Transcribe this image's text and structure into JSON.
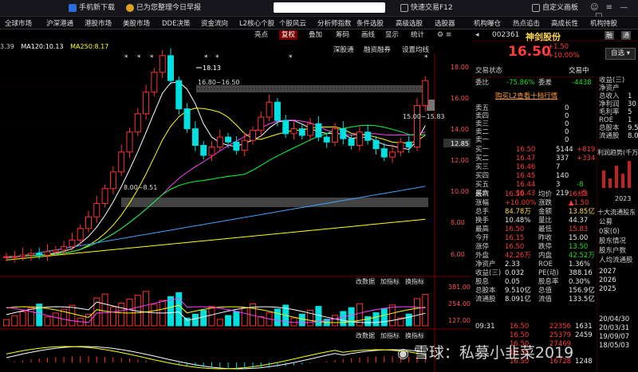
{
  "topbar": {
    "mobile_download": "手机新下载",
    "notice": "已为您整理今日早报",
    "search_placeholder": "",
    "fast_trade": "快速交易F12",
    "custom_interface": "自定义画板",
    "colors": {
      "bg": "#16161c",
      "accent": "#d0322a"
    }
  },
  "menubar": {
    "items": [
      "全球市场",
      "沪深港通",
      "港股市场",
      "美股市场",
      "DDE决策",
      "资金流向",
      "L2核心个股",
      "个股风云",
      "分析师指数",
      "条件选股",
      "高级选股",
      "选股器",
      "机构曝仓",
      "热点追击",
      "高成长性",
      "机构持股"
    ]
  },
  "toolbar2": {
    "buttons": [
      "亮点",
      "复权",
      "叠加",
      "筹码",
      "画线",
      "显示",
      "统计"
    ],
    "selected": "复权",
    "sub_buttons": [
      "深股通",
      "融资融券",
      "设置均线"
    ]
  },
  "ma_legend": {
    "prefix": "3.39",
    "items": [
      {
        "label": "MA120:10.13",
        "color": "#ffffff"
      },
      {
        "label": "MA250:8.17",
        "color": "#ffff00"
      }
    ]
  },
  "price_axis": [
    "18.00",
    "16.00",
    "14.00",
    "12.85",
    "12.00",
    "10.00",
    "8.00",
    "6.00"
  ],
  "annotations": {
    "high_label": "18.13",
    "range_label": "16.80~16.50",
    "band_label": "15.00~15.83",
    "low_label": "8.00~8.51"
  },
  "volume_panel": {
    "buttons": [
      "改数据",
      "加指标",
      "换指标"
    ],
    "axis": [
      "381.00",
      "254.00",
      "127.00"
    ]
  },
  "macd_panel": {
    "buttons": [
      "改数据",
      "加指标",
      "换指标"
    ]
  },
  "stock": {
    "code": "002361",
    "name": "神剑股份",
    "price": "16.50",
    "change": "+1.50",
    "change_pct": "+10.00%",
    "tags": [
      "融",
      "通"
    ],
    "watch_button": "自选",
    "status_label": "交易状态",
    "status_value": "交易中"
  },
  "orderbook": {
    "ratio_label": "委比",
    "ratio_value": "-75.86%",
    "diff_label": "委差",
    "diff_value": "-4438",
    "l2_button": "购买L2查看十档行情",
    "sells": [
      {
        "label": "卖五",
        "price": "",
        "vol": "0"
      },
      {
        "label": "卖四",
        "price": "",
        "vol": "0"
      },
      {
        "label": "卖三",
        "price": "",
        "vol": "0"
      },
      {
        "label": "卖二",
        "price": "",
        "vol": "0"
      },
      {
        "label": "卖一",
        "price": "",
        "vol": "0"
      }
    ],
    "buys": [
      {
        "label": "买一",
        "price": "16.50",
        "vol": "5144",
        "chg": "+819"
      },
      {
        "label": "买二",
        "price": "16.47",
        "vol": "337",
        "chg": "+334"
      },
      {
        "label": "买三",
        "price": "16.46",
        "vol": "7",
        "chg": ""
      },
      {
        "label": "买四",
        "price": "16.45",
        "vol": "140",
        "chg": ""
      },
      {
        "label": "买五",
        "price": "16.44",
        "vol": "3",
        "chg": "-8"
      },
      {
        "label": "买六",
        "price": "16.43",
        "vol": "219",
        "chg": "+5"
      }
    ]
  },
  "quotes": [
    {
      "l1": "最新",
      "v1": "16.50",
      "c1": "red",
      "l2": "均价",
      "v2": "16.33",
      "c2": "red"
    },
    {
      "l1": "涨幅",
      "v1": "+10.00%",
      "c1": "red",
      "l2": "涨跌",
      "v2": "▲1.50",
      "c2": "red"
    },
    {
      "l1": "总手",
      "v1": "84.78万",
      "c1": "yel",
      "l2": "金额",
      "v2": "13.85亿",
      "c2": "yel"
    },
    {
      "l1": "换手",
      "v1": "10.48%",
      "c1": "wht",
      "l2": "量比",
      "v2": "44.37",
      "c2": "wht"
    },
    {
      "l1": "最高",
      "v1": "16.50",
      "c1": "red",
      "l2": "最低",
      "v2": "15.83",
      "c2": "red"
    },
    {
      "l1": "今开",
      "v1": "16.15",
      "c1": "red",
      "l2": "昨收",
      "v2": "15.00",
      "c2": "wht"
    },
    {
      "l1": "涨停",
      "v1": "16.50",
      "c1": "red",
      "l2": "跌停",
      "v2": "13.50",
      "c2": "grn"
    },
    {
      "l1": "外盘",
      "v1": "42.26万",
      "c1": "red",
      "l2": "内盘",
      "v2": "42.52万",
      "c2": "grn"
    },
    {
      "l1": "净资产",
      "v1": "2.33",
      "c1": "wht",
      "l2": "ROE",
      "v2": "1.36%",
      "c2": "wht"
    },
    {
      "l1": "收益(三)",
      "v1": "0.032",
      "c1": "wht",
      "l2": "PE(动)",
      "v2": "388.16",
      "c2": "wht"
    },
    {
      "l1": "股息",
      "v1": "0.05",
      "c1": "wht",
      "l2": "股息率",
      "v2": "0.30%",
      "c2": "wht"
    },
    {
      "l1": "总股本",
      "v1": "9.510亿",
      "c1": "wht",
      "l2": "总值",
      "v2": "156.9亿",
      "c2": "wht"
    },
    {
      "l1": "流通股",
      "v1": "8.091亿",
      "c1": "wht",
      "l2": "流值",
      "v2": "133.5亿",
      "c2": "wht"
    }
  ],
  "ticks": [
    {
      "time": "09:31",
      "price": "16.50",
      "vol": "22356",
      "n": "1631"
    },
    {
      "time": "",
      "price": "16.50",
      "vol": "25379",
      "n": "2459"
    },
    {
      "time": "",
      "price": "16.50",
      "vol": "27469",
      "n": ""
    },
    {
      "time": "",
      "price": "16.50",
      "vol": "",
      "n": ""
    },
    {
      "time": "",
      "price": "16.50",
      "vol": "16728",
      "n": "1248"
    }
  ],
  "far_right": {
    "items": [
      "收益(三)",
      "净资产",
      "总收入",
      "净利润",
      "毛利率",
      "ROE",
      "总股本",
      "流通股"
    ],
    "values": [
      "",
      "",
      "1",
      "30",
      "5",
      "1",
      "9.5",
      "8.0"
    ],
    "trend_label": "利润趋势(千万)",
    "year_label": "2023",
    "holders_label": "十大流通股东",
    "holders_items": [
      "公募",
      "0家(0)",
      "股东情况",
      "股东户数",
      "人均流通股"
    ],
    "years": [
      "2027",
      "2026",
      "2025"
    ],
    "dates": [
      "20/04/30",
      "20/03/31",
      "19/09/07",
      "18/05/03"
    ]
  },
  "watermark": "雪球：私募小韭菜2019",
  "chart_data": {
    "type": "candlestick",
    "price_range": [
      5.0,
      19.0
    ],
    "candles_close_approx": [
      5.9,
      5.9,
      6.0,
      6.1,
      6.0,
      6.2,
      6.3,
      6.5,
      6.9,
      7.6,
      8.3,
      9.1,
      10.0,
      11.0,
      12.2,
      13.4,
      14.5,
      15.8,
      17.0,
      18.0,
      16.5,
      14.8,
      13.6,
      12.6,
      12.0,
      12.5,
      13.1,
      12.8,
      12.3,
      12.9,
      13.5,
      14.3,
      15.2,
      14.1,
      13.3,
      13.6,
      13.2,
      13.9,
      13.1,
      12.8,
      13.6,
      13.0,
      12.6,
      13.4,
      12.9,
      12.4,
      11.9,
      12.2,
      12.8,
      12.5,
      15.0,
      16.5
    ],
    "ma_series": [
      "MA5",
      "MA10",
      "MA20",
      "MA60",
      "MA120:10.13",
      "MA250:8.17"
    ],
    "volume_axis": [
      127,
      254,
      381
    ]
  }
}
